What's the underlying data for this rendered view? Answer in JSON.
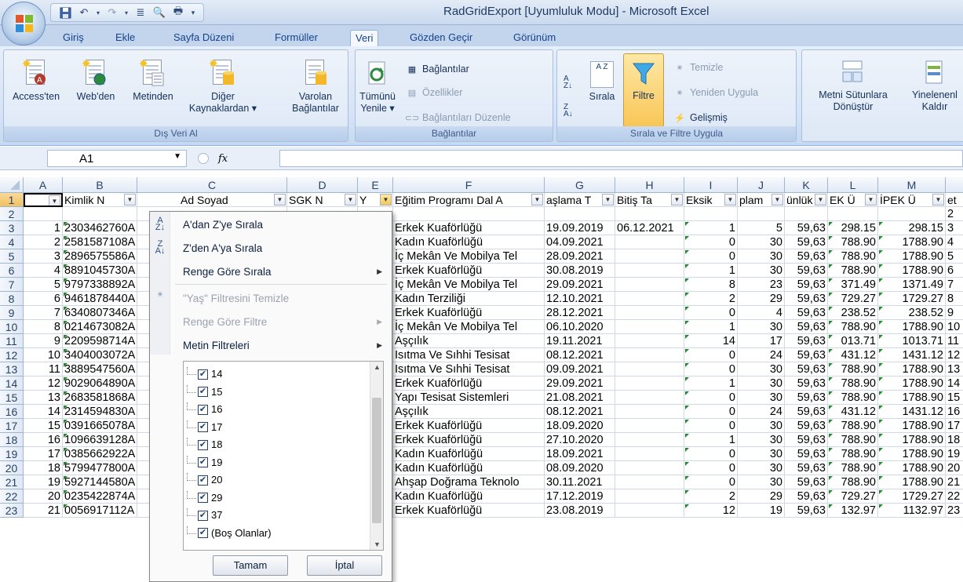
{
  "window": {
    "title": "RadGridExport  [Uyumluluk Modu] - Microsoft Excel"
  },
  "qat": {
    "icons": [
      "save-icon",
      "undo-icon",
      "redo-icon",
      "format-icon",
      "print-preview-icon",
      "print-icon",
      "customize-icon"
    ]
  },
  "tabs": [
    "Giriş",
    "Ekle",
    "Sayfa Düzeni",
    "Formüller",
    "Veri",
    "Gözden Geçir",
    "Görünüm"
  ],
  "active_tab": "Veri",
  "ribbon": {
    "dis_veri": {
      "label": "Dış Veri Al",
      "access": "Access'ten",
      "web": "Web'den",
      "metin": "Metinden",
      "diger_1": "Diğer",
      "diger_2": "Kaynaklardan ▾",
      "varolan_1": "Varolan",
      "varolan_2": "Bağlantılar"
    },
    "baglantilar": {
      "label": "Bağlantılar",
      "tumunu_1": "Tümünü",
      "tumunu_2": "Yenile ▾",
      "baglantilar": "Bağlantılar",
      "ozellikler": "Özellikler",
      "duzenle": "Bağlantıları Düzenle"
    },
    "sirala": {
      "label": "Sırala ve Filtre Uygula",
      "az": "A Z",
      "sirala": "Sırala",
      "filtre": "Filtre",
      "temizle": "Temizle",
      "yeniden": "Yeniden Uygula",
      "gelismis": "Gelişmiş"
    },
    "veri_araclari": {
      "metni_1": "Metni Sütunlara",
      "metni_2": "Dönüştür",
      "yinelenen_1": "Yinelenenl",
      "yinelenen_2": "Kaldır"
    }
  },
  "formula_bar": {
    "name_box": "A1",
    "fx": "fx",
    "value": ""
  },
  "columns": [
    "A",
    "B",
    "C",
    "D",
    "E",
    "F",
    "G",
    "H",
    "I",
    "J",
    "K",
    "L",
    "M"
  ],
  "header_row": [
    "",
    "Kimlik N",
    "Ad Soyad",
    "SGK N",
    "Y",
    "Eğitim Programı Dal A",
    "aşlama T",
    "Bitiş Ta",
    "Eksik",
    "plam",
    "ünlük",
    "EK Ü",
    "İPEK Ü",
    "et"
  ],
  "rows": [
    {
      "n": "2",
      "a": "",
      "b": "",
      "f": "",
      "g": "",
      "h": "",
      "i": "",
      "j": "",
      "k": "",
      "l": "",
      "m": ""
    },
    {
      "n": "3",
      "a": "1",
      "b": "2303462760A",
      "f": "Erkek Kuaförlüğü",
      "g": "19.09.2019",
      "h": "06.12.2021",
      "i": "1",
      "j": "5",
      "k": "59,63",
      "l": "298.15",
      "m": "298.15"
    },
    {
      "n": "4",
      "a": "2",
      "b": "2581587108A",
      "f": "Kadın Kuaförlüğü",
      "g": "04.09.2021",
      "h": "",
      "i": "0",
      "j": "30",
      "k": "59,63",
      "l": "788.90",
      "m": "1788.90"
    },
    {
      "n": "5",
      "a": "3",
      "b": "2896575586A",
      "f": "İç Mekân Ve Mobilya Tel",
      "g": "28.09.2021",
      "h": "",
      "i": "0",
      "j": "30",
      "k": "59,63",
      "l": "788.90",
      "m": "1788.90"
    },
    {
      "n": "6",
      "a": "4",
      "b": "8891045730A",
      "f": "Erkek Kuaförlüğü",
      "g": "30.08.2019",
      "h": "",
      "i": "1",
      "j": "30",
      "k": "59,63",
      "l": "788.90",
      "m": "1788.90"
    },
    {
      "n": "7",
      "a": "5",
      "b": "9797338892A",
      "f": "İç Mekân Ve Mobilya Tel",
      "g": "29.09.2021",
      "h": "",
      "i": "8",
      "j": "23",
      "k": "59,63",
      "l": "371.49",
      "m": "1371.49"
    },
    {
      "n": "8",
      "a": "6",
      "b": "9461878440A",
      "f": "Kadın Terziliği",
      "g": "12.10.2021",
      "h": "",
      "i": "2",
      "j": "29",
      "k": "59,63",
      "l": "729.27",
      "m": "1729.27"
    },
    {
      "n": "9",
      "a": "7",
      "b": "6340807346A",
      "f": "Erkek Kuaförlüğü",
      "g": "28.12.2021",
      "h": "",
      "i": "0",
      "j": "4",
      "k": "59,63",
      "l": "238.52",
      "m": "238.52"
    },
    {
      "n": "10",
      "a": "8",
      "b": "0214673082A",
      "f": "İç Mekân Ve Mobilya Tel",
      "g": "06.10.2020",
      "h": "",
      "i": "1",
      "j": "30",
      "k": "59,63",
      "l": "788.90",
      "m": "1788.90"
    },
    {
      "n": "11",
      "a": "9",
      "b": "2209598714A",
      "f": "Aşçılık",
      "g": "19.11.2021",
      "h": "",
      "i": "14",
      "j": "17",
      "k": "59,63",
      "l": "013.71",
      "m": "1013.71"
    },
    {
      "n": "12",
      "a": "10",
      "b": "3404003072A",
      "f": "Isıtma Ve Sıhhi Tesisat",
      "g": "08.12.2021",
      "h": "",
      "i": "0",
      "j": "24",
      "k": "59,63",
      "l": "431.12",
      "m": "1431.12"
    },
    {
      "n": "13",
      "a": "11",
      "b": "3889547560A",
      "f": "Isıtma Ve Sıhhi Tesisat",
      "g": "09.09.2021",
      "h": "",
      "i": "0",
      "j": "30",
      "k": "59,63",
      "l": "788.90",
      "m": "1788.90"
    },
    {
      "n": "14",
      "a": "12",
      "b": "9029064890A",
      "f": "Erkek Kuaförlüğü",
      "g": "29.09.2021",
      "h": "",
      "i": "1",
      "j": "30",
      "k": "59,63",
      "l": "788.90",
      "m": "1788.90"
    },
    {
      "n": "15",
      "a": "13",
      "b": "2683581868A",
      "f": "Yapı Tesisat Sistemleri",
      "g": "21.08.2021",
      "h": "",
      "i": "0",
      "j": "30",
      "k": "59,63",
      "l": "788.90",
      "m": "1788.90"
    },
    {
      "n": "16",
      "a": "14",
      "b": "2314594830A",
      "f": "Aşçılık",
      "g": "08.12.2021",
      "h": "",
      "i": "0",
      "j": "24",
      "k": "59,63",
      "l": "431.12",
      "m": "1431.12"
    },
    {
      "n": "17",
      "a": "15",
      "b": "0391665078A",
      "f": "Erkek Kuaförlüğü",
      "g": "18.09.2020",
      "h": "",
      "i": "0",
      "j": "30",
      "k": "59,63",
      "l": "788.90",
      "m": "1788.90"
    },
    {
      "n": "18",
      "a": "16",
      "b": "1096639128A",
      "f": "Erkek Kuaförlüğü",
      "g": "27.10.2020",
      "h": "",
      "i": "1",
      "j": "30",
      "k": "59,63",
      "l": "788.90",
      "m": "1788.90"
    },
    {
      "n": "19",
      "a": "17",
      "b": "0385662922A",
      "f": "Kadın Kuaförlüğü",
      "g": "18.09.2021",
      "h": "",
      "i": "0",
      "j": "30",
      "k": "59,63",
      "l": "788.90",
      "m": "1788.90"
    },
    {
      "n": "20",
      "a": "18",
      "b": "5799477800A",
      "f": "Kadın Kuaförlüğü",
      "g": "08.09.2020",
      "h": "",
      "i": "0",
      "j": "30",
      "k": "59,63",
      "l": "788.90",
      "m": "1788.90"
    },
    {
      "n": "21",
      "a": "19",
      "b": "5927144580A",
      "f": "Ahşap Doğrama Teknolo",
      "g": "30.11.2021",
      "h": "",
      "i": "0",
      "j": "30",
      "k": "59,63",
      "l": "788.90",
      "m": "1788.90"
    },
    {
      "n": "22",
      "a": "20",
      "b": "0235422874A",
      "f": "Kadın Kuaförlüğü",
      "g": "17.12.2019",
      "h": "",
      "i": "2",
      "j": "29",
      "k": "59,63",
      "l": "729.27",
      "m": "1729.27"
    },
    {
      "n": "23",
      "a": "21",
      "b": "0056917112A",
      "f": "Erkek Kuaförlüğü",
      "g": "23.08.2019",
      "h": "",
      "i": "12",
      "j": "19",
      "k": "59,63",
      "l": "132.97",
      "m": "1132.97"
    }
  ],
  "filter_menu": {
    "sort_az": "A'dan Z'ye Sırala",
    "sort_za": "Z'den A'ya Sırala",
    "sort_color": "Renge Göre Sırala",
    "clear_filter": "\"Yaş\" Filtresini Temizle",
    "filter_color": "Renge Göre Filtre",
    "text_filters": "Metin Filtreleri",
    "items": [
      "14",
      "15",
      "16",
      "17",
      "18",
      "19",
      "20",
      "29",
      "37",
      "(Boş Olanlar)"
    ],
    "ok": "Tamam",
    "cancel": "İptal"
  }
}
